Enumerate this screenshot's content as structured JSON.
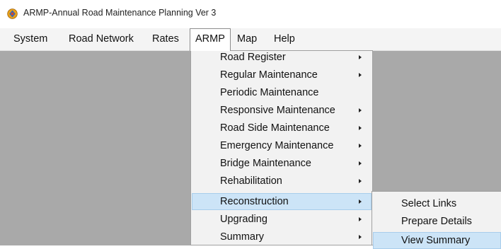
{
  "window": {
    "title": "ARMP-Annual Road Maintenance Planning Ver 3",
    "icon": "app-logo-icon"
  },
  "menubar": {
    "items": [
      {
        "label": "System"
      },
      {
        "label": "Road Network"
      },
      {
        "label": "Rates"
      },
      {
        "label": "ARMP",
        "active": true
      },
      {
        "label": "Map"
      },
      {
        "label": "Help"
      }
    ]
  },
  "armp_menu": {
    "items": [
      {
        "label": "Road Register",
        "has_submenu": true
      },
      {
        "label": "Regular Maintenance",
        "has_submenu": true
      },
      {
        "label": "Periodic Maintenance",
        "has_submenu": false
      },
      {
        "label": "Responsive Maintenance",
        "has_submenu": true
      },
      {
        "label": "Road Side Maintenance",
        "has_submenu": true
      },
      {
        "label": "Emergency Maintenance",
        "has_submenu": true
      },
      {
        "label": "Bridge Maintenance",
        "has_submenu": true
      },
      {
        "label": "Rehabilitation",
        "has_submenu": true
      },
      {
        "label": "Reconstruction",
        "has_submenu": true,
        "highlighted": true
      },
      {
        "label": "Upgrading",
        "has_submenu": true
      },
      {
        "label": "Summary",
        "has_submenu": true
      }
    ]
  },
  "reconstruction_submenu": {
    "items": [
      {
        "label": "Select Links"
      },
      {
        "label": "Prepare Details"
      },
      {
        "label": "View Summary",
        "highlighted": true
      }
    ]
  },
  "colors": {
    "menu_highlight": "#cce4f7",
    "client_background": "#a9a9a9",
    "menu_background": "#f2f2f2"
  }
}
